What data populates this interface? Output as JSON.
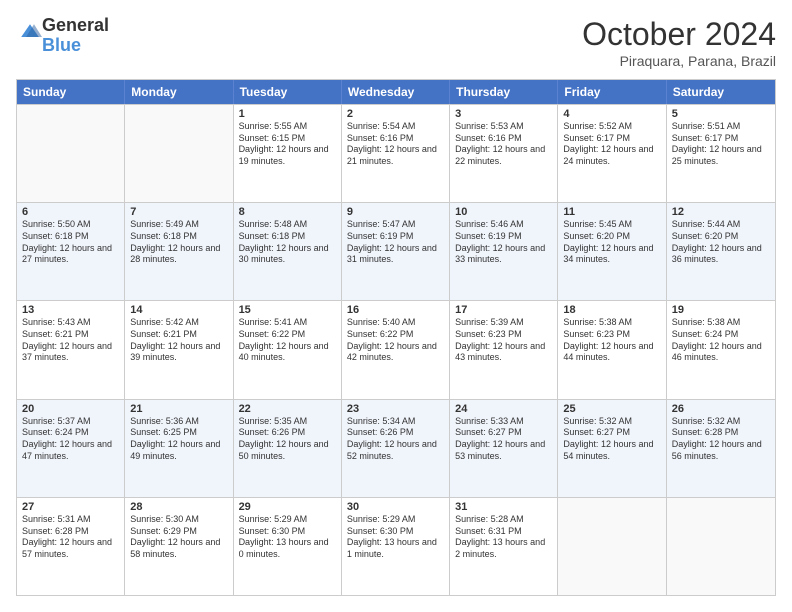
{
  "logo": {
    "general": "General",
    "blue": "Blue"
  },
  "header": {
    "month": "October 2024",
    "location": "Piraquara, Parana, Brazil"
  },
  "weekdays": [
    "Sunday",
    "Monday",
    "Tuesday",
    "Wednesday",
    "Thursday",
    "Friday",
    "Saturday"
  ],
  "rows": [
    [
      {
        "day": "",
        "text": ""
      },
      {
        "day": "",
        "text": ""
      },
      {
        "day": "1",
        "text": "Sunrise: 5:55 AM\nSunset: 6:15 PM\nDaylight: 12 hours and 19 minutes."
      },
      {
        "day": "2",
        "text": "Sunrise: 5:54 AM\nSunset: 6:16 PM\nDaylight: 12 hours and 21 minutes."
      },
      {
        "day": "3",
        "text": "Sunrise: 5:53 AM\nSunset: 6:16 PM\nDaylight: 12 hours and 22 minutes."
      },
      {
        "day": "4",
        "text": "Sunrise: 5:52 AM\nSunset: 6:17 PM\nDaylight: 12 hours and 24 minutes."
      },
      {
        "day": "5",
        "text": "Sunrise: 5:51 AM\nSunset: 6:17 PM\nDaylight: 12 hours and 25 minutes."
      }
    ],
    [
      {
        "day": "6",
        "text": "Sunrise: 5:50 AM\nSunset: 6:18 PM\nDaylight: 12 hours and 27 minutes."
      },
      {
        "day": "7",
        "text": "Sunrise: 5:49 AM\nSunset: 6:18 PM\nDaylight: 12 hours and 28 minutes."
      },
      {
        "day": "8",
        "text": "Sunrise: 5:48 AM\nSunset: 6:18 PM\nDaylight: 12 hours and 30 minutes."
      },
      {
        "day": "9",
        "text": "Sunrise: 5:47 AM\nSunset: 6:19 PM\nDaylight: 12 hours and 31 minutes."
      },
      {
        "day": "10",
        "text": "Sunrise: 5:46 AM\nSunset: 6:19 PM\nDaylight: 12 hours and 33 minutes."
      },
      {
        "day": "11",
        "text": "Sunrise: 5:45 AM\nSunset: 6:20 PM\nDaylight: 12 hours and 34 minutes."
      },
      {
        "day": "12",
        "text": "Sunrise: 5:44 AM\nSunset: 6:20 PM\nDaylight: 12 hours and 36 minutes."
      }
    ],
    [
      {
        "day": "13",
        "text": "Sunrise: 5:43 AM\nSunset: 6:21 PM\nDaylight: 12 hours and 37 minutes."
      },
      {
        "day": "14",
        "text": "Sunrise: 5:42 AM\nSunset: 6:21 PM\nDaylight: 12 hours and 39 minutes."
      },
      {
        "day": "15",
        "text": "Sunrise: 5:41 AM\nSunset: 6:22 PM\nDaylight: 12 hours and 40 minutes."
      },
      {
        "day": "16",
        "text": "Sunrise: 5:40 AM\nSunset: 6:22 PM\nDaylight: 12 hours and 42 minutes."
      },
      {
        "day": "17",
        "text": "Sunrise: 5:39 AM\nSunset: 6:23 PM\nDaylight: 12 hours and 43 minutes."
      },
      {
        "day": "18",
        "text": "Sunrise: 5:38 AM\nSunset: 6:23 PM\nDaylight: 12 hours and 44 minutes."
      },
      {
        "day": "19",
        "text": "Sunrise: 5:38 AM\nSunset: 6:24 PM\nDaylight: 12 hours and 46 minutes."
      }
    ],
    [
      {
        "day": "20",
        "text": "Sunrise: 5:37 AM\nSunset: 6:24 PM\nDaylight: 12 hours and 47 minutes."
      },
      {
        "day": "21",
        "text": "Sunrise: 5:36 AM\nSunset: 6:25 PM\nDaylight: 12 hours and 49 minutes."
      },
      {
        "day": "22",
        "text": "Sunrise: 5:35 AM\nSunset: 6:26 PM\nDaylight: 12 hours and 50 minutes."
      },
      {
        "day": "23",
        "text": "Sunrise: 5:34 AM\nSunset: 6:26 PM\nDaylight: 12 hours and 52 minutes."
      },
      {
        "day": "24",
        "text": "Sunrise: 5:33 AM\nSunset: 6:27 PM\nDaylight: 12 hours and 53 minutes."
      },
      {
        "day": "25",
        "text": "Sunrise: 5:32 AM\nSunset: 6:27 PM\nDaylight: 12 hours and 54 minutes."
      },
      {
        "day": "26",
        "text": "Sunrise: 5:32 AM\nSunset: 6:28 PM\nDaylight: 12 hours and 56 minutes."
      }
    ],
    [
      {
        "day": "27",
        "text": "Sunrise: 5:31 AM\nSunset: 6:28 PM\nDaylight: 12 hours and 57 minutes."
      },
      {
        "day": "28",
        "text": "Sunrise: 5:30 AM\nSunset: 6:29 PM\nDaylight: 12 hours and 58 minutes."
      },
      {
        "day": "29",
        "text": "Sunrise: 5:29 AM\nSunset: 6:30 PM\nDaylight: 13 hours and 0 minutes."
      },
      {
        "day": "30",
        "text": "Sunrise: 5:29 AM\nSunset: 6:30 PM\nDaylight: 13 hours and 1 minute."
      },
      {
        "day": "31",
        "text": "Sunrise: 5:28 AM\nSunset: 6:31 PM\nDaylight: 13 hours and 2 minutes."
      },
      {
        "day": "",
        "text": ""
      },
      {
        "day": "",
        "text": ""
      }
    ]
  ]
}
